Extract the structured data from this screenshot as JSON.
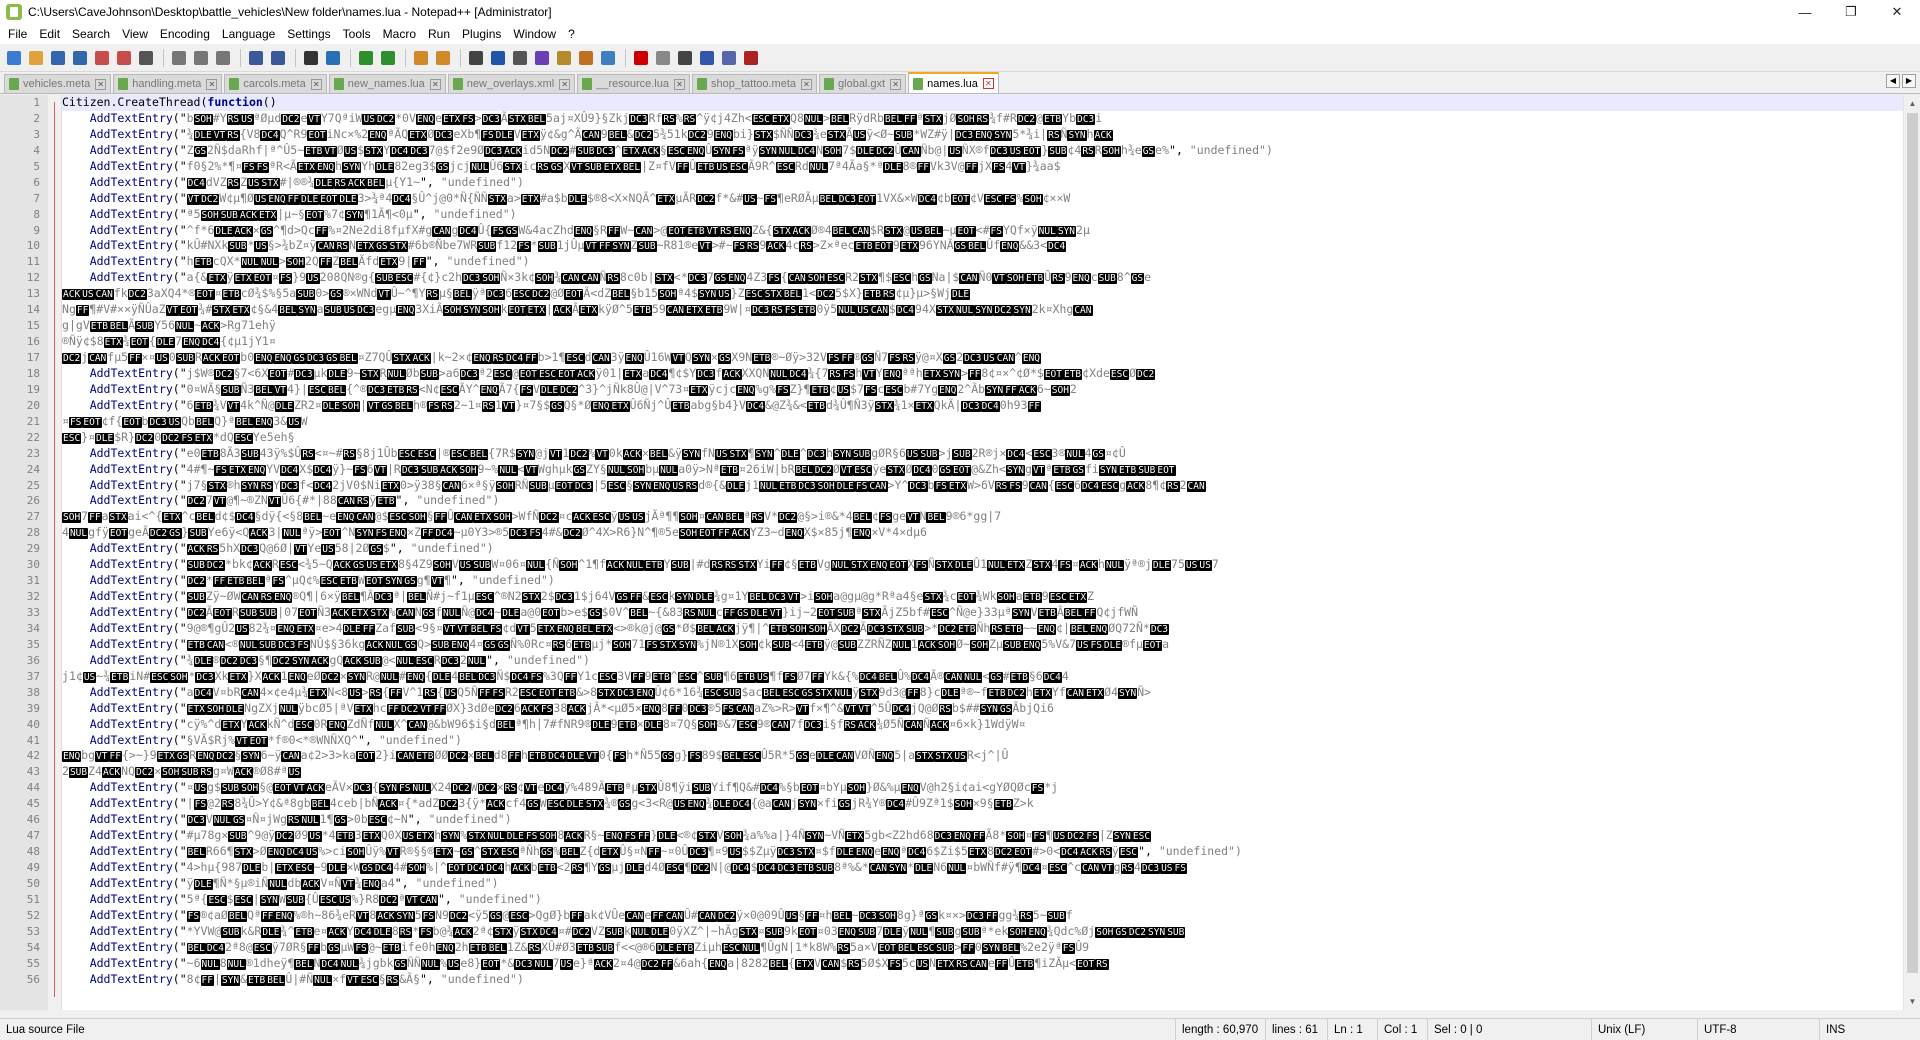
{
  "window": {
    "title": "C:\\Users\\CaveJohnson\\Desktop\\battle_vehicles\\New folder\\names.lua - Notepad++ [Administrator]",
    "controls": [
      "—",
      "❐",
      "✕"
    ]
  },
  "menu": [
    "File",
    "Edit",
    "Search",
    "View",
    "Encoding",
    "Language",
    "Settings",
    "Tools",
    "Macro",
    "Run",
    "Plugins",
    "Window",
    "?"
  ],
  "toolbar": {
    "icons": [
      "new-file-icon",
      "open-file-icon",
      "save-icon",
      "save-all-icon",
      "close-icon",
      "close-all-icon",
      "print-icon",
      "cut-icon",
      "copy-icon",
      "paste-icon",
      "undo-icon",
      "redo-icon",
      "find-icon",
      "replace-icon",
      "zoom-in-icon",
      "zoom-out-icon",
      "sync-vertical-icon",
      "sync-horizontal-icon",
      "word-wrap-icon",
      "show-all-chars-icon",
      "indent-guide-icon",
      "doc-map-icon",
      "function-list-icon",
      "folder-as-workspace-icon",
      "monitoring-icon",
      "record-macro-icon",
      "stop-record-icon",
      "play-macro-icon",
      "run-macro-multiple-icon",
      "save-macro-icon",
      "spell-check-icon"
    ]
  },
  "tabs": [
    {
      "label": "vehicles.meta",
      "active": false
    },
    {
      "label": "handling.meta",
      "active": false
    },
    {
      "label": "carcols.meta",
      "active": false
    },
    {
      "label": "new_names.lua",
      "active": false
    },
    {
      "label": "new_overlays.xml",
      "active": false
    },
    {
      "label": "__resource.lua",
      "active": false
    },
    {
      "label": "shop_tattoo.meta",
      "active": false
    },
    {
      "label": "global.gxt",
      "active": false
    },
    {
      "label": "names.lua",
      "active": true
    }
  ],
  "editor": {
    "line_numbers": [
      "1",
      "2",
      "3",
      "4",
      "5",
      "6",
      "7",
      "8",
      "9",
      "10",
      "11",
      "12",
      "13",
      "14",
      "15",
      "16",
      "17",
      "18",
      "19",
      "20",
      "21",
      "22",
      "23",
      "24",
      "25",
      "26",
      "27",
      "28",
      "29",
      "30",
      "31",
      "32",
      "33",
      "34",
      "35",
      "36",
      "37",
      "38",
      "39",
      "40",
      "41",
      "42",
      "43",
      "44",
      "45",
      "46",
      "47",
      "48",
      "49",
      "50",
      "51",
      "52",
      "53",
      "54",
      "55",
      "56"
    ],
    "first_line": "Citizen.CreateThread(function()",
    "keyword": "function",
    "call": "AddTextEntry",
    "undefined_label": "\"undefined\")"
  },
  "status": {
    "file_type": "Lua source File",
    "length": "length : 60,970",
    "lines": "lines : 61",
    "ln": "Ln : 1",
    "col": "Col : 1",
    "sel": "Sel : 0 | 0",
    "eol": "Unix (LF)",
    "encoding": "UTF-8",
    "mode": "INS"
  }
}
